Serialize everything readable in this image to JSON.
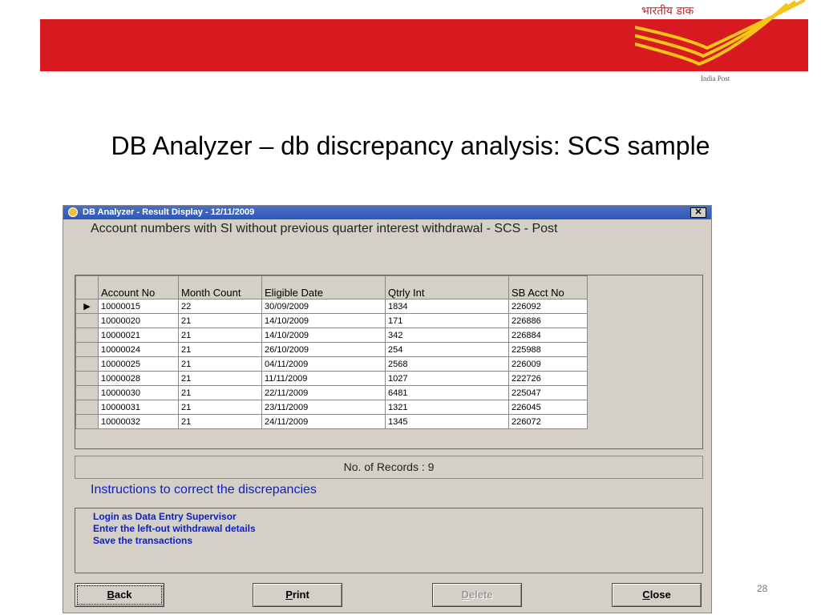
{
  "slide": {
    "logo_hindi": "भारतीय डाक",
    "logo_caption": "India Post",
    "title": "DB Analyzer – db discrepancy analysis: SCS sample",
    "page_number": "28"
  },
  "window": {
    "title": "DB Analyzer - Result Display - 12/11/2009",
    "close_glyph": "✕",
    "heading": "Account numbers with SI without previous quarter interest withdrawal - SCS - Post",
    "grid": {
      "columns": [
        "Account No",
        "Month Count",
        "Eligible Date",
        "Qtrly Int",
        "SB Acct No"
      ],
      "current_row_marker": "▶",
      "rows": [
        [
          "10000015",
          "22",
          "30/09/2009",
          "1834",
          "226092"
        ],
        [
          "10000020",
          "21",
          "14/10/2009",
          "171",
          "226886"
        ],
        [
          "10000021",
          "21",
          "14/10/2009",
          "342",
          "226884"
        ],
        [
          "10000024",
          "21",
          "26/10/2009",
          "254",
          "225988"
        ],
        [
          "10000025",
          "21",
          "04/11/2009",
          "2568",
          "226009"
        ],
        [
          "10000028",
          "21",
          "11/11/2009",
          "1027",
          "222726"
        ],
        [
          "10000030",
          "21",
          "22/11/2009",
          "6481",
          "225047"
        ],
        [
          "10000031",
          "21",
          "23/11/2009",
          "1321",
          "226045"
        ],
        [
          "10000032",
          "21",
          "24/11/2009",
          "1345",
          "226072"
        ]
      ]
    },
    "records_text": "No. of Records : 9",
    "instructions_title": "Instructions to correct the discrepancies",
    "instructions": [
      "Login as Data Entry Supervisor",
      "Enter the left-out withdrawal details",
      "Save the transactions"
    ],
    "buttons": {
      "back": {
        "key": "B",
        "rest": "ack"
      },
      "print": {
        "key": "P",
        "rest": "rint"
      },
      "delete": {
        "key": "D",
        "rest": "elete"
      },
      "close": {
        "key": "C",
        "rest": "lose"
      }
    }
  },
  "colors": {
    "banner_red": "#d71a1f",
    "logo_yellow": "#f5c518",
    "instruction_blue": "#1020c0",
    "window_face": "#d4d0c8"
  }
}
